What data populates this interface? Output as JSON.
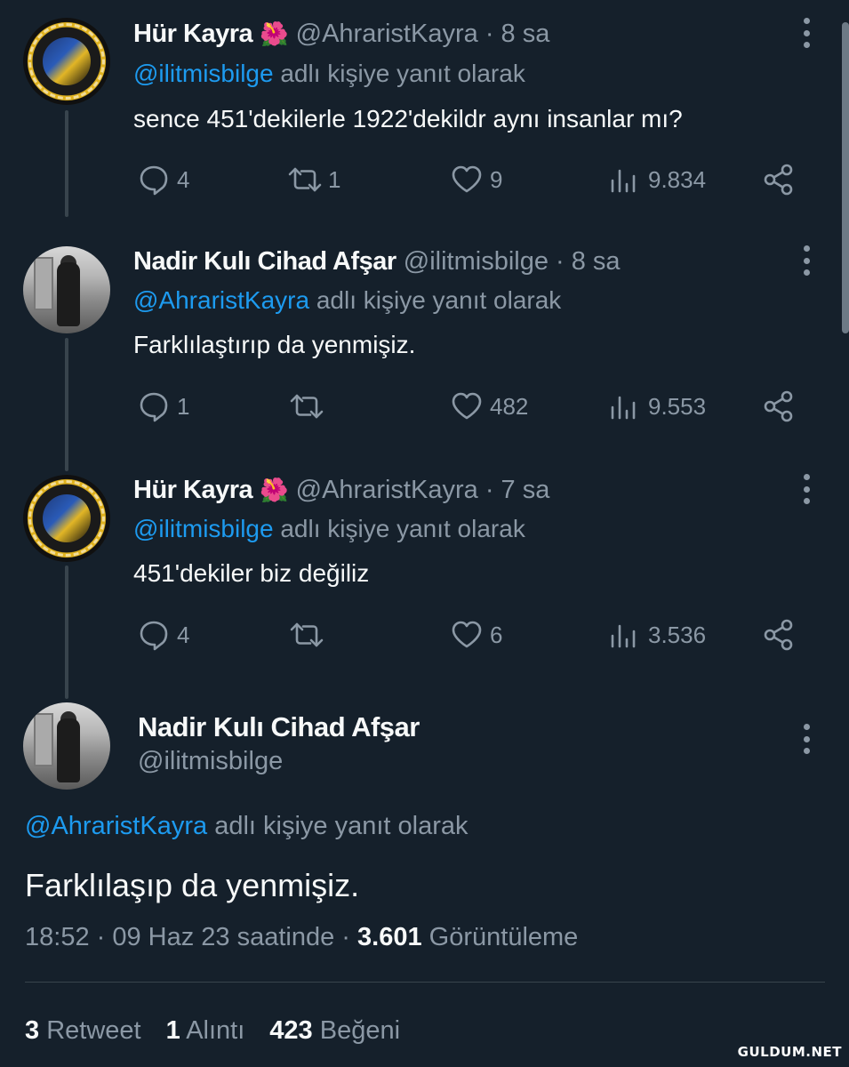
{
  "thread": [
    {
      "name": "Hür Kayra",
      "emoji": "🌺",
      "handle": "@AhraristKayra",
      "time": "· 8 sa",
      "reply_mention": "@ilitmisbilge",
      "reply_suffix": "adlı kişiye yanıt olarak",
      "text": "sence 451'dekilerle 1922'dekildr aynı insanlar mı?",
      "replies": "4",
      "retweets": "1",
      "likes": "9",
      "views": "9.834"
    },
    {
      "name": "Nadir Kulı Cihad Afşar",
      "handle": "@ilitmisbilge",
      "time": "· 8 sa",
      "reply_mention": "@AhraristKayra",
      "reply_suffix": "adlı kişiye yanıt olarak",
      "text": "Farklılaştırıp da yenmişiz.",
      "replies": "1",
      "retweets": "",
      "likes": "482",
      "views": "9.553"
    },
    {
      "name": "Hür Kayra",
      "emoji": "🌺",
      "handle": "@AhraristKayra",
      "time": "· 7 sa",
      "reply_mention": "@ilitmisbilge",
      "reply_suffix": "adlı kişiye yanıt olarak",
      "text": "451'dekiler biz değiliz",
      "replies": "4",
      "retweets": "",
      "likes": "6",
      "views": "3.536"
    }
  ],
  "main": {
    "name": "Nadir Kulı Cihad Afşar",
    "handle": "@ilitmisbilge",
    "reply_mention": "@AhraristKayra",
    "reply_suffix": "adlı kişiye yanıt olarak",
    "text": "Farklılaşıp da yenmişiz.",
    "timestamp": "18:52 · 09 Haz 23 saatinde ·",
    "views_count": "3.601",
    "views_label": "Görüntüleme",
    "retweets_count": "3",
    "retweets_label": "Retweet",
    "quotes_count": "1",
    "quotes_label": "Alıntı",
    "likes_count": "423",
    "likes_label": "Beğeni"
  },
  "watermark": "GULDUM.NET",
  "icons": [
    "reply-icon",
    "retweet-icon",
    "like-icon",
    "views-icon",
    "share-icon",
    "more-icon"
  ],
  "colors": {
    "background": "#15202b",
    "link": "#1d9bf0",
    "muted": "#8b98a5",
    "text": "#f7f9f9"
  }
}
